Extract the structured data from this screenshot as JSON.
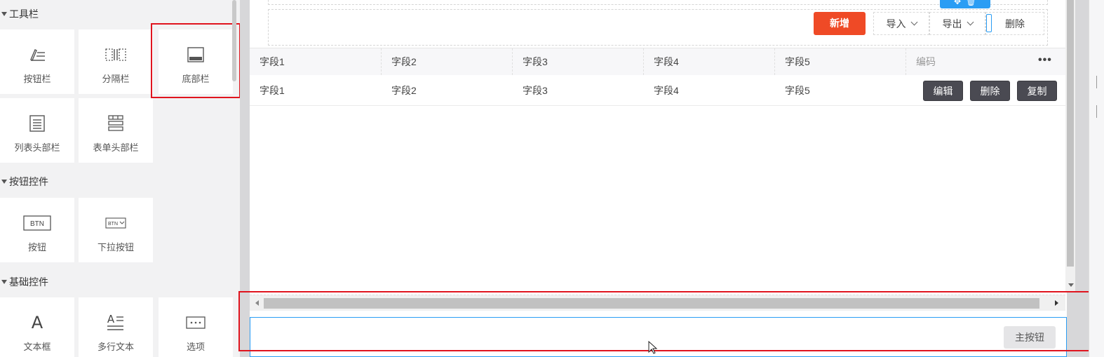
{
  "palette": {
    "sections": [
      {
        "title": "工具栏",
        "items": [
          {
            "label": "按钮栏",
            "icon": "pen-lines-icon"
          },
          {
            "label": "分隔栏",
            "icon": "divider-icon"
          },
          {
            "label": "底部栏",
            "icon": "footer-bar-icon",
            "selected": true
          },
          {
            "label": "列表头部栏",
            "icon": "list-header-icon"
          },
          {
            "label": "表单头部栏",
            "icon": "form-header-icon"
          }
        ]
      },
      {
        "title": "按钮控件",
        "items": [
          {
            "label": "按钮",
            "icon": "btn-icon",
            "icon_text": "BTN"
          },
          {
            "label": "下拉按钮",
            "icon": "dropdown-btn-icon",
            "icon_text": "BTN"
          }
        ]
      },
      {
        "title": "基础控件",
        "items": [
          {
            "label": "文本框",
            "icon": "text-a-icon",
            "icon_text": "A"
          },
          {
            "label": "多行文本",
            "icon": "multiline-text-icon",
            "icon_text": "A"
          },
          {
            "label": "选项",
            "icon": "options-icon"
          }
        ]
      }
    ]
  },
  "toolbar": {
    "add_label": "新增",
    "import_label": "导入",
    "export_label": "导出",
    "delete_label": "删除"
  },
  "table": {
    "headers": [
      "字段1",
      "字段2",
      "字段3",
      "字段4",
      "字段5",
      "编码"
    ],
    "row": [
      "字段1",
      "字段2",
      "字段3",
      "字段4",
      "字段5"
    ],
    "more_label": "•••",
    "row_actions": [
      "编辑",
      "删除",
      "复制"
    ]
  },
  "bottom_bar": {
    "primary_button_label": "主按钮"
  },
  "colors": {
    "add_button": "#ef4a26",
    "selection": "#e0141e",
    "focus": "#2a9df4",
    "row_action_bg": "#4a4a52"
  }
}
